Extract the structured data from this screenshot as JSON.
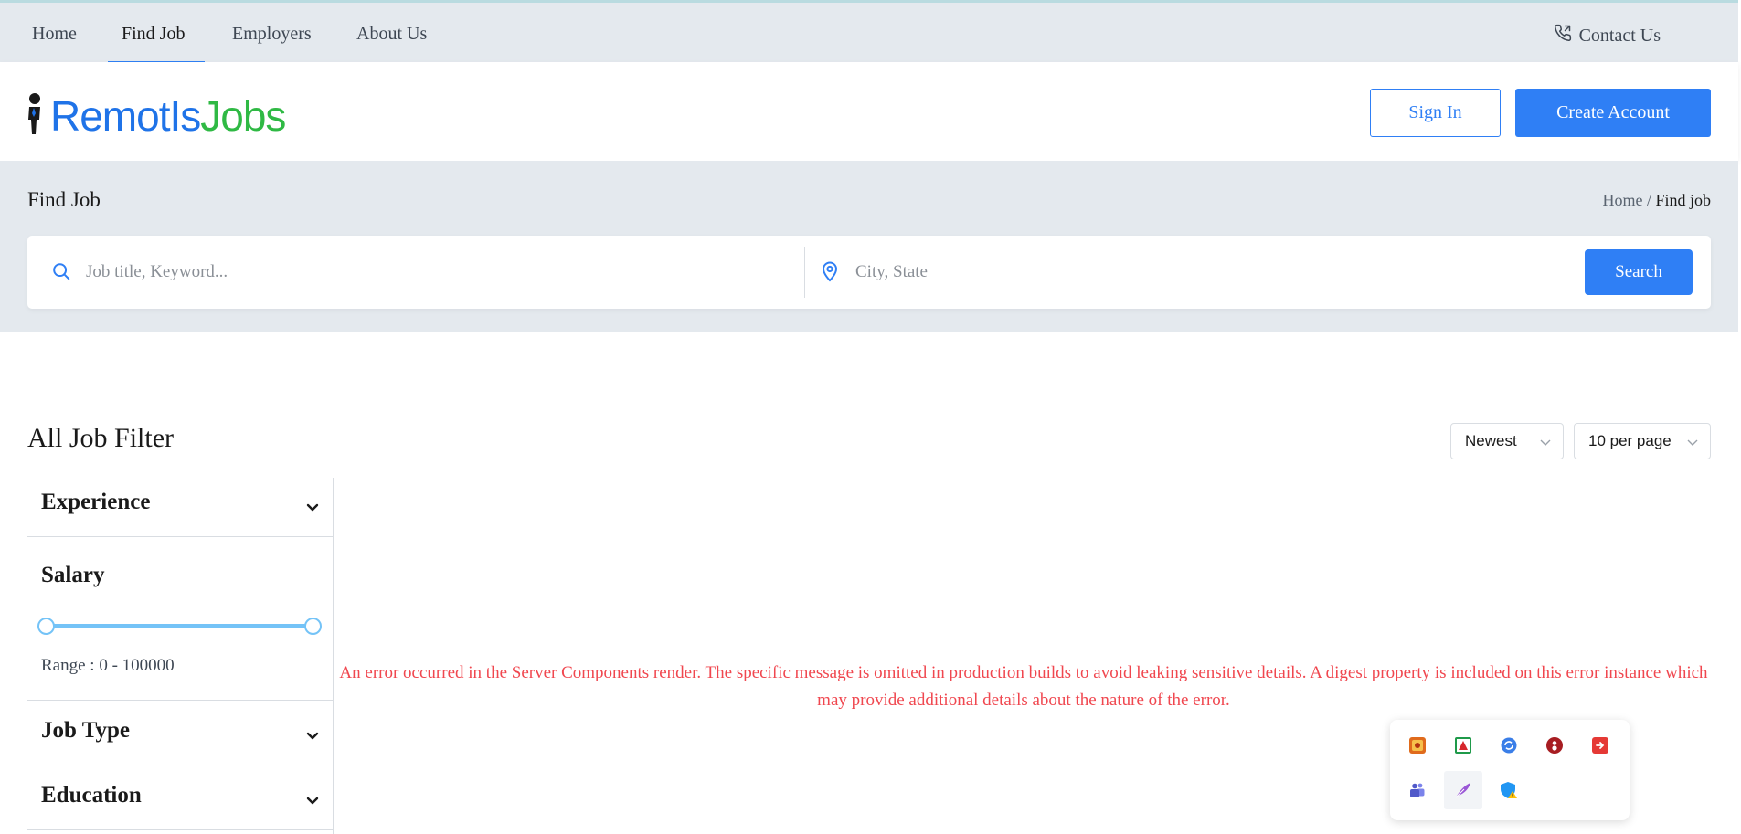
{
  "topnav": {
    "items": [
      {
        "label": "Home"
      },
      {
        "label": "Find Job"
      },
      {
        "label": "Employers"
      },
      {
        "label": "About Us"
      }
    ],
    "active": "Find Job",
    "contact_label": "Contact Us"
  },
  "header": {
    "logo": {
      "part1": "RemotIs",
      "part2": "Jobs"
    },
    "signin_label": "Sign In",
    "create_label": "Create Account"
  },
  "hero": {
    "title": "Find Job",
    "breadcrumb": {
      "home": "Home",
      "separator": " / ",
      "current": "Find job"
    },
    "search": {
      "keyword_placeholder": "Job title, Keyword...",
      "location_placeholder": "City, State",
      "button_label": "Search"
    }
  },
  "listing": {
    "title": "All Job Filter",
    "sort": {
      "selected": "Newest"
    },
    "per_page": {
      "selected": "10 per page"
    }
  },
  "filters": {
    "experience": "Experience",
    "salary": {
      "label": "Salary",
      "range_text": "Range : 0 - 100000",
      "min": 0,
      "max": 100000
    },
    "job_type": "Job Type",
    "education": "Education"
  },
  "error": {
    "message": "An error occurred in the Server Components render. The specific message is omitted in production builds to avoid leaking sensitive details. A digest property is included on this error instance which may provide additional details about the nature of the error."
  },
  "colors": {
    "primary": "#2f7ff5",
    "logo_blue": "#1f73e8",
    "logo_green": "#2fb944",
    "error": "#f0474f",
    "band_bg": "#e4e9ee"
  }
}
